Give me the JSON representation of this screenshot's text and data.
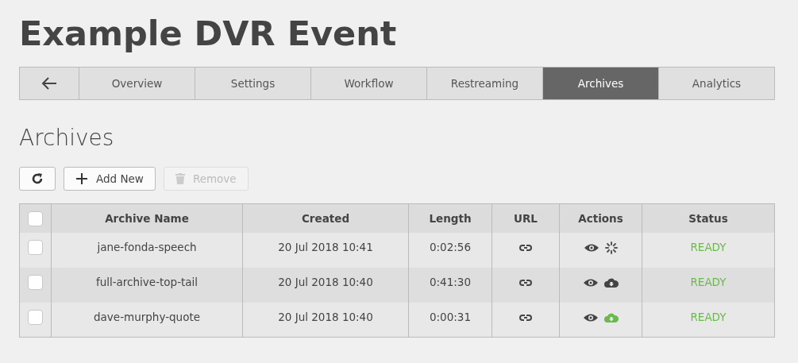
{
  "title": "Example DVR Event",
  "tabs": [
    {
      "kind": "back",
      "selected": false
    },
    {
      "label": "Overview",
      "selected": false
    },
    {
      "label": "Settings",
      "selected": false
    },
    {
      "label": "Workflow",
      "selected": false
    },
    {
      "label": "Restreaming",
      "selected": false
    },
    {
      "label": "Archives",
      "selected": true
    },
    {
      "label": "Analytics",
      "selected": false
    }
  ],
  "section_title": "Archives",
  "toolbar": [
    {
      "kind": "refresh",
      "disabled": false
    },
    {
      "kind": "add",
      "label": "Add New",
      "disabled": false
    },
    {
      "kind": "remove",
      "label": "Remove",
      "disabled": true
    }
  ],
  "table": {
    "select_all": {
      "checked": false
    },
    "columns": [
      "Archive Name",
      "Created",
      "Length",
      "URL",
      "Actions",
      "Status"
    ],
    "rows": [
      {
        "checked": false,
        "name": "jane-fonda-speech",
        "created": "20 Jul 2018 10:41",
        "length": "0:02:56",
        "actions": [
          {
            "kind": "view"
          },
          {
            "kind": "processing"
          }
        ],
        "status": "READY"
      },
      {
        "checked": false,
        "name": "full-archive-top-tail",
        "created": "20 Jul 2018 10:40",
        "length": "0:41:30",
        "actions": [
          {
            "kind": "view"
          },
          {
            "kind": "download"
          }
        ],
        "status": "READY"
      },
      {
        "checked": false,
        "name": "dave-murphy-quote",
        "created": "20 Jul 2018 10:40",
        "length": "0:00:31",
        "actions": [
          {
            "kind": "view"
          },
          {
            "kind": "downloaded"
          }
        ],
        "status": "READY"
      }
    ]
  }
}
